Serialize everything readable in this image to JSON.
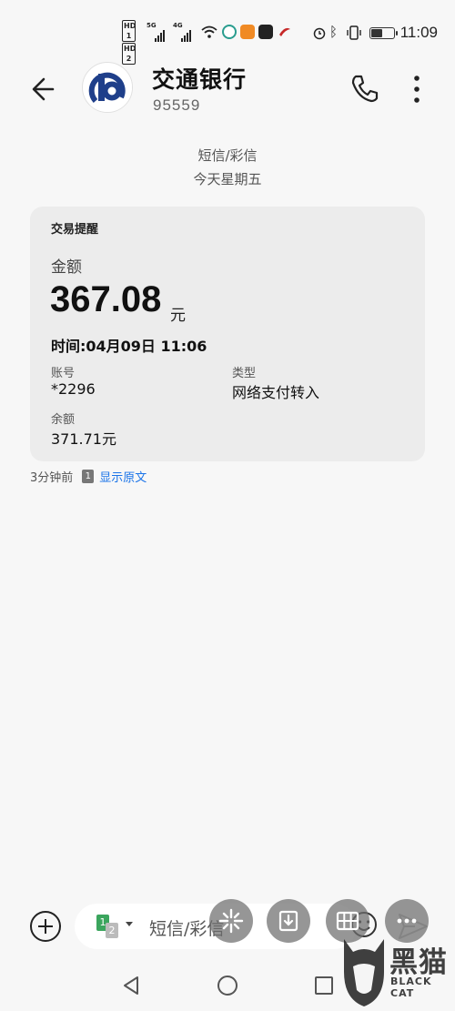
{
  "status_bar": {
    "time": "11:09",
    "hd1": "HD 1",
    "hd2": "HD 2",
    "net1": "5G",
    "net2": "4G",
    "battery_level": 0.45,
    "icons": [
      "signal-icon",
      "signal-icon",
      "wifi-icon",
      "app-icon",
      "app-icon",
      "app-icon",
      "app-icon",
      "alarm-icon",
      "bluetooth-icon",
      "vibrate-icon",
      "battery-icon"
    ]
  },
  "header": {
    "title": "交通银行",
    "number": "95559",
    "icons": {
      "back": "back-arrow-icon",
      "avatar": "bank-logo-icon",
      "call": "phone-icon",
      "more": "more-vertical-icon"
    }
  },
  "separator": {
    "type": "短信/彩信",
    "day": "今天星期五"
  },
  "message": {
    "title": "交易提醒",
    "amount_label": "金额",
    "amount": "367.08",
    "amount_unit": "元",
    "time_line": "时间:04月09日 11:06",
    "account_label": "账号",
    "account_value": "*2296",
    "type_label": "类型",
    "type_value": "网络支付转入",
    "balance_label": "余额",
    "balance_value": "371.71元",
    "age": "3分钟前",
    "sim_badge": "1",
    "show_original": "显示原文"
  },
  "compose": {
    "placeholder": "短信/彩信",
    "sim_a": "1",
    "sim_b": "2",
    "icons": {
      "add": "plus-circle-icon",
      "emoji": "emoji-icon",
      "send": "send-icon"
    }
  },
  "bubbles": {
    "icons": [
      "sparkle-icon",
      "download-icon",
      "grid-icon",
      "more-horizontal-icon"
    ]
  },
  "nav": {
    "icons": [
      "nav-back-icon",
      "nav-home-icon",
      "nav-recent-icon"
    ]
  },
  "watermark": {
    "text": "黑猫",
    "sub": "BLACK CAT"
  },
  "colors": {
    "background": "#f7f7f7",
    "card": "#ececec",
    "link": "#1a73e8",
    "logo": "#1f3f8a",
    "sim_green": "#3ba55d"
  }
}
